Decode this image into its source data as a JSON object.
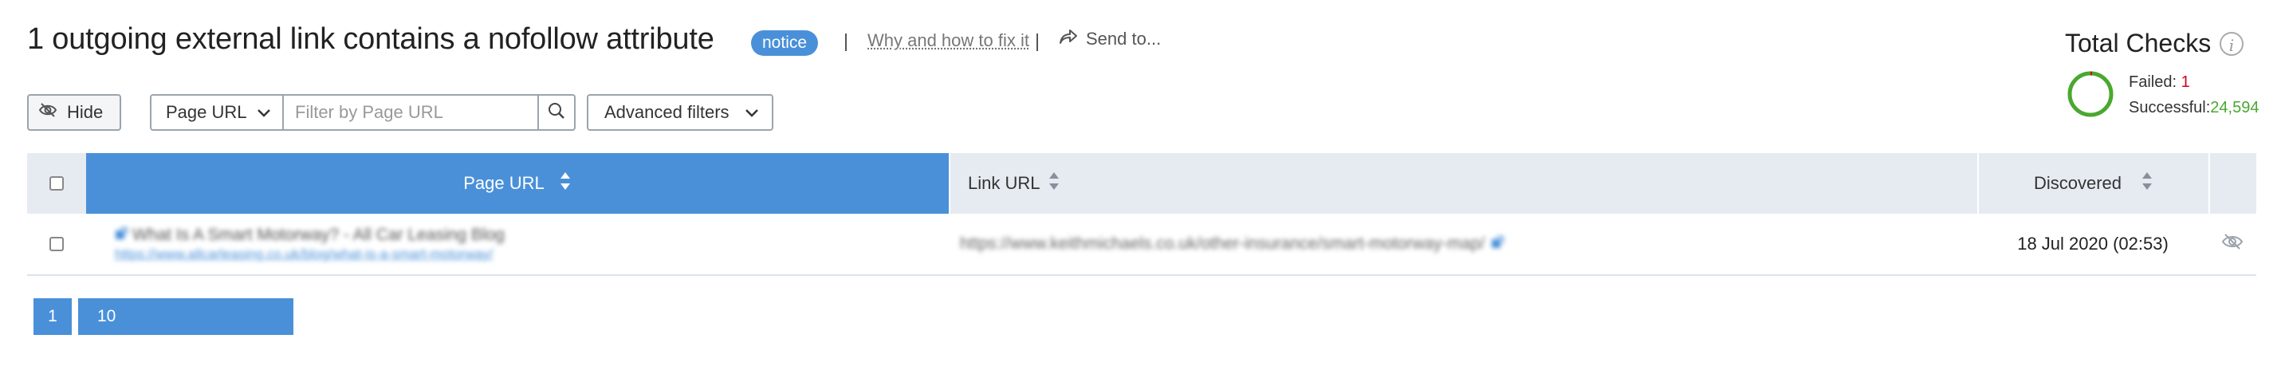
{
  "header": {
    "title": "1 outgoing external link contains a nofollow attribute",
    "badge": "notice",
    "why_link": "Why and how to fix it",
    "send_label": "Send to..."
  },
  "total_checks": {
    "title": "Total Checks",
    "failed_label": "Failed:",
    "failed_value": "1",
    "successful_label": "Successful:",
    "successful_value": "24,594"
  },
  "toolbar": {
    "hide_label": "Hide",
    "filter_select_value": "Page URL",
    "filter_placeholder": "Filter by Page URL",
    "advanced_filters_label": "Advanced filters"
  },
  "table": {
    "columns": [
      "Page URL",
      "Link URL",
      "Discovered"
    ],
    "rows": [
      {
        "page_title": "What Is A Smart Motorway? - All Car Leasing Blog",
        "page_url": "https://www.allcarleasing.co.uk/blog/what-is-a-smart-motorway/",
        "link_url": "https://www.keithmichaels.co.uk/other-insurance/smart-motorway-map/",
        "discovered": "18 Jul 2020 (02:53)"
      }
    ]
  },
  "pagination": {
    "current_page": "1",
    "per_page": "10"
  },
  "colors": {
    "accent": "#4a90d9",
    "failed": "#d0021b",
    "successful": "#4aa82f",
    "header_bg": "#e6ebf2"
  },
  "icons": {
    "hide": "eye-slash-icon",
    "send": "share-arrow-icon",
    "info": "info-icon",
    "search": "search-icon",
    "chevron": "chevron-down-icon",
    "sort": "sort-icon",
    "external": "external-link-icon",
    "row_hide": "eye-slash-icon"
  }
}
